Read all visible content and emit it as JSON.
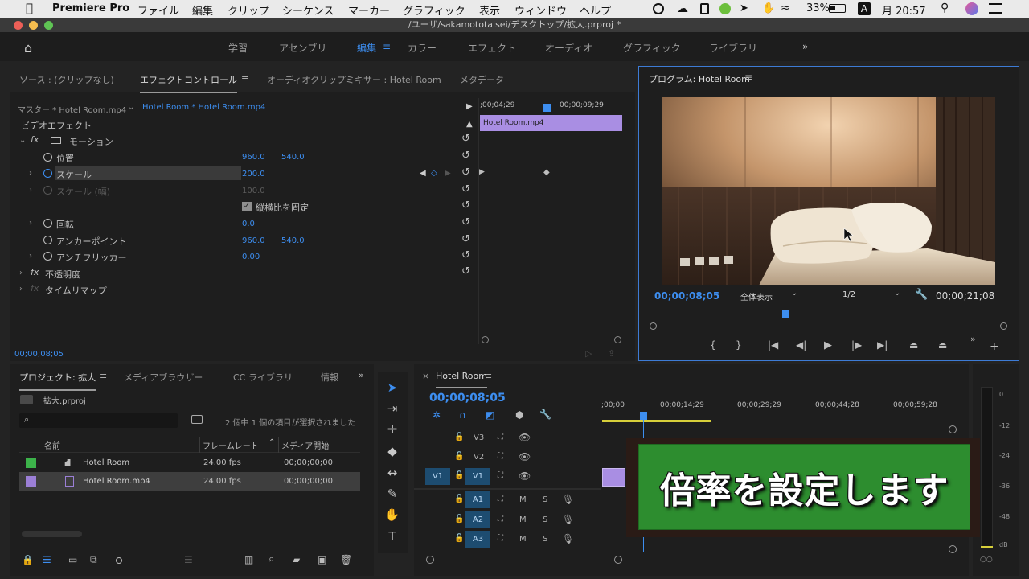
{
  "menubar": {
    "app": "Premiere Pro",
    "items": [
      "ファイル",
      "編集",
      "クリップ",
      "シーケンス",
      "マーカー",
      "グラフィック",
      "表示",
      "ウィンドウ",
      "ヘルプ"
    ],
    "battery": "33%",
    "clock": "月 20:57"
  },
  "window": {
    "title": "/ユーザ/sakamototaisei/デスクトップ/拡大.prproj *"
  },
  "workspaces": {
    "items": [
      "学習",
      "アセンブリ",
      "編集",
      "カラー",
      "エフェクト",
      "オーディオ",
      "グラフィック",
      "ライブラリ"
    ],
    "active": "編集",
    "more": "»"
  },
  "effect_panel": {
    "tabs": [
      "ソース : (クリップなし)",
      "エフェクトコントロール",
      "オーディオクリップミキサー : Hotel Room",
      "メタデータ"
    ],
    "master": "マスター * Hotel Room.mp4",
    "clip": "Hotel Room * Hotel Room.mp4",
    "section": "ビデオエフェクト",
    "motion": "モーション",
    "position": {
      "label": "位置",
      "x": "960.0",
      "y": "540.0"
    },
    "scale": {
      "label": "スケール",
      "value": "200.0"
    },
    "scale_width": {
      "label": "スケール (幅)",
      "value": "100.0"
    },
    "uniform": "縦横比を固定",
    "rotation": {
      "label": "回転",
      "value": "0.0"
    },
    "anchor": {
      "label": "アンカーポイント",
      "x": "960.0",
      "y": "540.0"
    },
    "flicker": {
      "label": "アンチフリッカー",
      "value": "0.00"
    },
    "opacity": "不透明度",
    "timeremap": "タイムリマップ",
    "timecode": "00;00;08;05",
    "mini_ruler": [
      ";00;04;29",
      "00;00;09;29"
    ],
    "mini_clip": "Hotel Room.mp4"
  },
  "program": {
    "title": "プログラム: Hotel Room",
    "timecode": "00;00;08;05",
    "fit": "全体表示",
    "resolution": "1/2",
    "duration": "00;00;21;08"
  },
  "project": {
    "tabs": [
      "プロジェクト: 拡大",
      "メディアブラウザー",
      "CC ライブラリ",
      "情報"
    ],
    "file": "拡大.prproj",
    "selection_info": "2 個中 1 個の項目が選択されました",
    "columns": [
      "名前",
      "フレームレート",
      "メディア開始"
    ],
    "rows": [
      {
        "name": "Hotel Room",
        "fps": "24.00 fps",
        "start": "00;00;00;00",
        "color": "#3cb24a"
      },
      {
        "name": "Hotel Room.mp4",
        "fps": "24.00 fps",
        "start": "00;00;00;00",
        "color": "#9b7fd6"
      }
    ]
  },
  "timeline": {
    "tab": "Hotel Room",
    "timecode": "00;00;08;05",
    "ruler": [
      ";00;00",
      "00;00;14;29",
      "00;00;29;29",
      "00;00;44;28",
      "00;00;59;28"
    ],
    "video_tracks": [
      {
        "src": "",
        "name": "V3"
      },
      {
        "src": "",
        "name": "V2"
      },
      {
        "src": "V1",
        "name": "V1"
      }
    ],
    "audio_tracks": [
      "A1",
      "A2",
      "A3"
    ],
    "mute": "M",
    "solo": "S"
  },
  "overlay": {
    "caption": "倍率を設定します"
  },
  "meter": {
    "labels": [
      "0",
      "-12",
      "-24",
      "-36",
      "-48",
      "dB"
    ]
  }
}
